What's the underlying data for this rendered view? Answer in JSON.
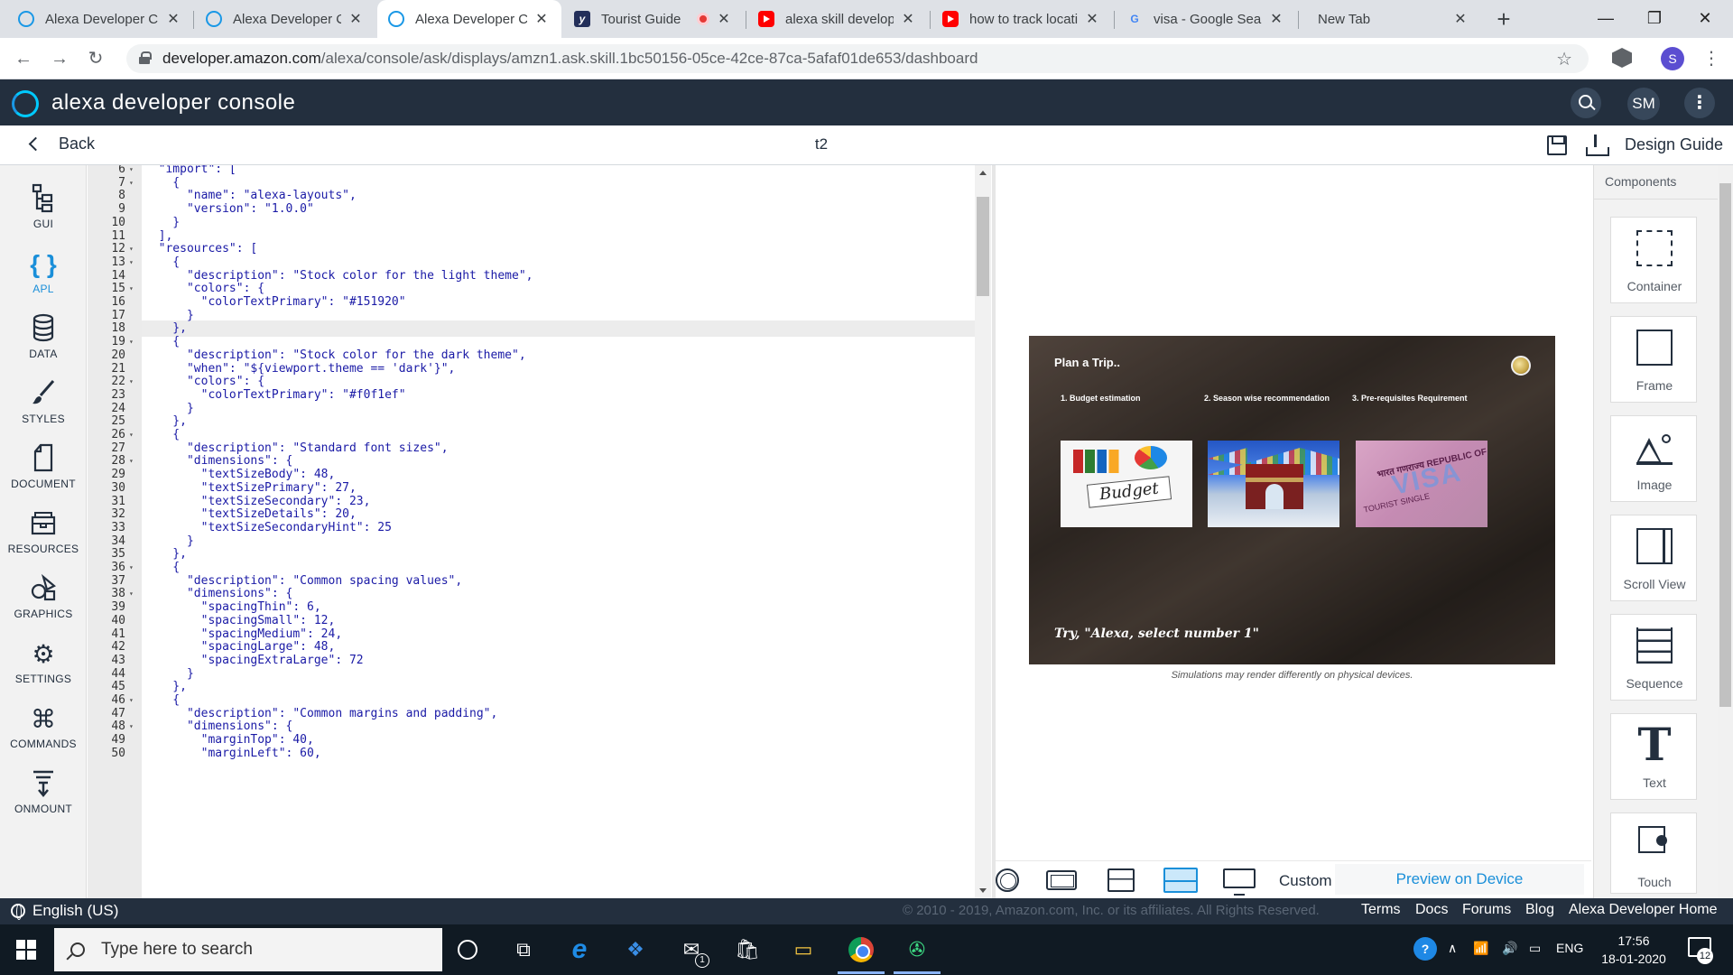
{
  "browser": {
    "tabs": [
      {
        "title": "Alexa Developer C",
        "favicon": "alexa-icon",
        "active": false
      },
      {
        "title": "Alexa Developer C",
        "favicon": "alexa-icon",
        "active": false
      },
      {
        "title": "Alexa Developer C",
        "favicon": "alexa-icon",
        "active": true
      },
      {
        "title": "Tourist Guide",
        "favicon": "tourist-guide-icon",
        "active": false,
        "recording": true
      },
      {
        "title": "alexa skill develop",
        "favicon": "youtube-icon",
        "active": false
      },
      {
        "title": "how to track locati",
        "favicon": "youtube-icon",
        "active": false
      },
      {
        "title": "visa - Google Sear",
        "favicon": "google-icon",
        "active": false
      },
      {
        "title": "New Tab",
        "favicon": "",
        "active": false
      }
    ],
    "url_host": "developer.amazon.com",
    "url_path": "/alexa/console/ask/displays/amzn1.ask.skill.1bc50156-05ce-42ce-87ca-5afaf01de653/dashboard",
    "profile_initial": "S"
  },
  "header": {
    "title": "alexa developer console",
    "user_initials": "SM"
  },
  "subheader": {
    "back_label": "Back",
    "document_name": "t2",
    "design_guide_label": "Design Guide"
  },
  "leftnav": {
    "items": [
      {
        "label": "GUI",
        "icon": "gui-icon",
        "active": false
      },
      {
        "label": "APL",
        "icon": "braces-icon",
        "active": true
      },
      {
        "label": "DATA",
        "icon": "database-icon",
        "active": false
      },
      {
        "label": "STYLES",
        "icon": "brush-icon",
        "active": false
      },
      {
        "label": "DOCUMENT",
        "icon": "document-icon",
        "active": false
      },
      {
        "label": "RESOURCES",
        "icon": "resources-icon",
        "active": false
      },
      {
        "label": "GRAPHICS",
        "icon": "graphics-icon",
        "active": false
      },
      {
        "label": "SETTINGS",
        "icon": "gear-icon",
        "active": false
      },
      {
        "label": "COMMANDS",
        "icon": "command-icon",
        "active": false
      },
      {
        "label": "ONMOUNT",
        "icon": "onmount-icon",
        "active": false
      }
    ]
  },
  "editor": {
    "cursor_line": 18,
    "lines": [
      {
        "n": 6,
        "fold": true,
        "text": "  \"import\": ["
      },
      {
        "n": 7,
        "fold": true,
        "text": "    {"
      },
      {
        "n": 8,
        "fold": false,
        "text": "      \"name\": \"alexa-layouts\","
      },
      {
        "n": 9,
        "fold": false,
        "text": "      \"version\": \"1.0.0\""
      },
      {
        "n": 10,
        "fold": false,
        "text": "    }"
      },
      {
        "n": 11,
        "fold": false,
        "text": "  ],"
      },
      {
        "n": 12,
        "fold": true,
        "text": "  \"resources\": ["
      },
      {
        "n": 13,
        "fold": true,
        "text": "    {"
      },
      {
        "n": 14,
        "fold": false,
        "text": "      \"description\": \"Stock color for the light theme\","
      },
      {
        "n": 15,
        "fold": true,
        "text": "      \"colors\": {"
      },
      {
        "n": 16,
        "fold": false,
        "text": "        \"colorTextPrimary\": \"#151920\""
      },
      {
        "n": 17,
        "fold": false,
        "text": "      }"
      },
      {
        "n": 18,
        "fold": false,
        "text": "    },"
      },
      {
        "n": 19,
        "fold": true,
        "text": "    {"
      },
      {
        "n": 20,
        "fold": false,
        "text": "      \"description\": \"Stock color for the dark theme\","
      },
      {
        "n": 21,
        "fold": false,
        "text": "      \"when\": \"${viewport.theme == 'dark'}\","
      },
      {
        "n": 22,
        "fold": true,
        "text": "      \"colors\": {"
      },
      {
        "n": 23,
        "fold": false,
        "text": "        \"colorTextPrimary\": \"#f0f1ef\""
      },
      {
        "n": 24,
        "fold": false,
        "text": "      }"
      },
      {
        "n": 25,
        "fold": false,
        "text": "    },"
      },
      {
        "n": 26,
        "fold": true,
        "text": "    {"
      },
      {
        "n": 27,
        "fold": false,
        "text": "      \"description\": \"Standard font sizes\","
      },
      {
        "n": 28,
        "fold": true,
        "text": "      \"dimensions\": {"
      },
      {
        "n": 29,
        "fold": false,
        "text": "        \"textSizeBody\": 48,"
      },
      {
        "n": 30,
        "fold": false,
        "text": "        \"textSizePrimary\": 27,"
      },
      {
        "n": 31,
        "fold": false,
        "text": "        \"textSizeSecondary\": 23,"
      },
      {
        "n": 32,
        "fold": false,
        "text": "        \"textSizeDetails\": 20,"
      },
      {
        "n": 33,
        "fold": false,
        "text": "        \"textSizeSecondaryHint\": 25"
      },
      {
        "n": 34,
        "fold": false,
        "text": "      }"
      },
      {
        "n": 35,
        "fold": false,
        "text": "    },"
      },
      {
        "n": 36,
        "fold": true,
        "text": "    {"
      },
      {
        "n": 37,
        "fold": false,
        "text": "      \"description\": \"Common spacing values\","
      },
      {
        "n": 38,
        "fold": true,
        "text": "      \"dimensions\": {"
      },
      {
        "n": 39,
        "fold": false,
        "text": "        \"spacingThin\": 6,"
      },
      {
        "n": 40,
        "fold": false,
        "text": "        \"spacingSmall\": 12,"
      },
      {
        "n": 41,
        "fold": false,
        "text": "        \"spacingMedium\": 24,"
      },
      {
        "n": 42,
        "fold": false,
        "text": "        \"spacingLarge\": 48,"
      },
      {
        "n": 43,
        "fold": false,
        "text": "        \"spacingExtraLarge\": 72"
      },
      {
        "n": 44,
        "fold": false,
        "text": "      }"
      },
      {
        "n": 45,
        "fold": false,
        "text": "    },"
      },
      {
        "n": 46,
        "fold": true,
        "text": "    {"
      },
      {
        "n": 47,
        "fold": false,
        "text": "      \"description\": \"Common margins and padding\","
      },
      {
        "n": 48,
        "fold": true,
        "text": "      \"dimensions\": {"
      },
      {
        "n": 49,
        "fold": false,
        "text": "        \"marginTop\": 40,"
      },
      {
        "n": 50,
        "fold": false,
        "text": "        \"marginLeft\": 60,"
      }
    ]
  },
  "preview": {
    "sim_title": "Plan a Trip..",
    "options": [
      "1. Budget estimation",
      "2. Season wise recommendation",
      "3. Pre-requisites Requirement"
    ],
    "card_budget_text": "Budget",
    "card_visa_text_1": "भारत गणराज्य REPUBLIC OF INDIA",
    "card_visa_text_2": "VISA",
    "card_visa_text_3": "TOURIST   SINGLE",
    "hint": "Try, \"Alexa, select number 1\"",
    "note": "Simulations may render differently on physical devices.",
    "custom_label": "Custom",
    "preview_on_device_label": "Preview on Device"
  },
  "components": {
    "title": "Components",
    "items": [
      {
        "label": "Container",
        "icon": "container-icon"
      },
      {
        "label": "Frame",
        "icon": "frame-icon"
      },
      {
        "label": "Image",
        "icon": "image-icon"
      },
      {
        "label": "Scroll View",
        "icon": "scroll-view-icon"
      },
      {
        "label": "Sequence",
        "icon": "sequence-icon"
      },
      {
        "label": "Text",
        "icon": "text-icon"
      },
      {
        "label": "Touch",
        "icon": "touch-icon"
      }
    ],
    "text_glyph": "T"
  },
  "footer": {
    "language": "English (US)",
    "copyright": "© 2010 - 2019, Amazon.com, Inc. or its affiliates. All Rights Reserved.",
    "links": [
      "Terms",
      "Docs",
      "Forums",
      "Blog",
      "Alexa Developer Home"
    ]
  },
  "taskbar": {
    "search_placeholder": "Type here to search",
    "mail_badge": "1",
    "language": "ENG",
    "time": "17:56",
    "date": "18-01-2020",
    "notification_count": "12"
  }
}
